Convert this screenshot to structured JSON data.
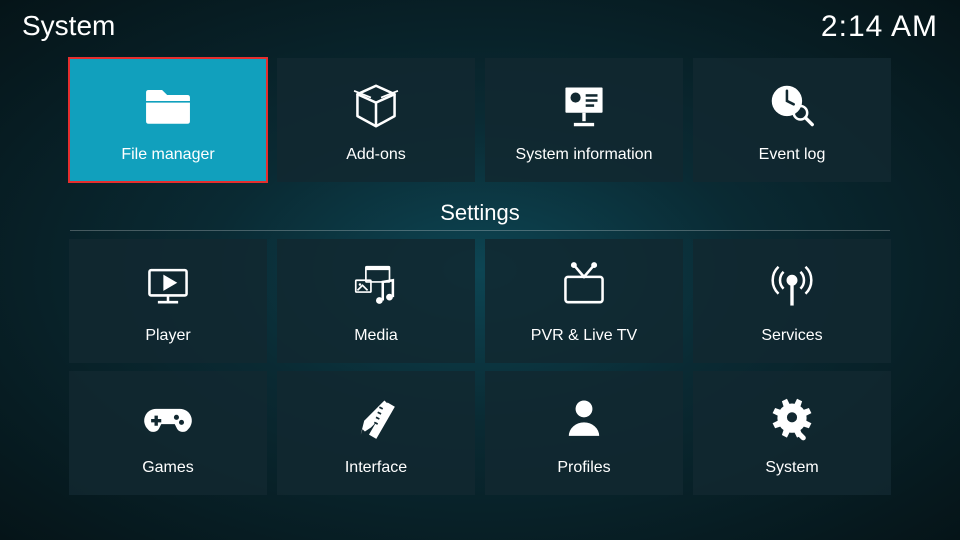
{
  "header": {
    "title": "System",
    "clock": "2:14 AM"
  },
  "section_title": "Settings",
  "top_tiles": [
    {
      "label": "File manager"
    },
    {
      "label": "Add-ons"
    },
    {
      "label": "System information"
    },
    {
      "label": "Event log"
    }
  ],
  "settings_tiles": [
    {
      "label": "Player"
    },
    {
      "label": "Media"
    },
    {
      "label": "PVR & Live TV"
    },
    {
      "label": "Services"
    },
    {
      "label": "Games"
    },
    {
      "label": "Interface"
    },
    {
      "label": "Profiles"
    },
    {
      "label": "System"
    }
  ],
  "selected_tile": "File manager"
}
